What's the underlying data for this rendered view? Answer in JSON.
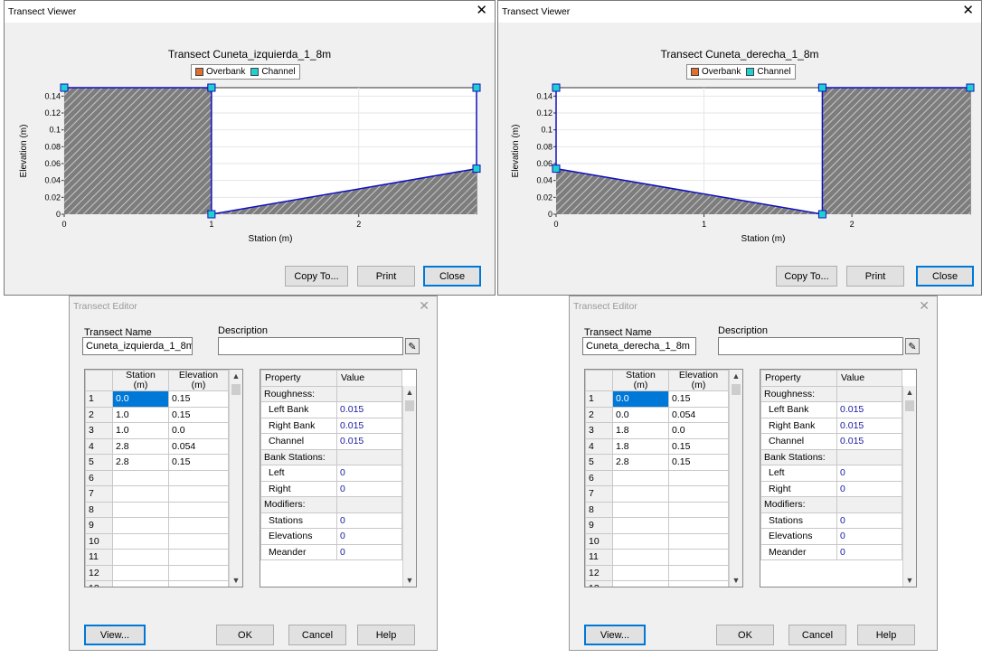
{
  "viewers": [
    {
      "title": "Transect Viewer",
      "chart_title": "Transect Cuneta_izquierda_1_8m",
      "legend": [
        "Overbank",
        "Channel"
      ],
      "buttons": {
        "copy": "Copy To...",
        "print": "Print",
        "close": "Close"
      }
    },
    {
      "title": "Transect Viewer",
      "chart_title": "Transect Cuneta_derecha_1_8m",
      "legend": [
        "Overbank",
        "Channel"
      ],
      "buttons": {
        "copy": "Copy To...",
        "print": "Print",
        "close": "Close"
      }
    }
  ],
  "chart_data": [
    {
      "type": "area",
      "title": "Transect Cuneta_izquierda_1_8m",
      "xlabel": "Station (m)",
      "ylabel": "Elevation (m)",
      "x_ticks": [
        "0",
        "1",
        "2"
      ],
      "y_ticks": [
        "0",
        "0.02",
        "0.04",
        "0.06",
        "0.08",
        "0.1",
        "0.12",
        "0.14"
      ],
      "xlim": [
        0,
        2.8
      ],
      "ylim": [
        0,
        0.15
      ],
      "series": [
        {
          "name": "Overbank",
          "points": [
            [
              0,
              0.15
            ],
            [
              1.0,
              0.15
            ]
          ]
        },
        {
          "name": "Channel",
          "points": [
            [
              1.0,
              0.15
            ],
            [
              1.0,
              0.0
            ],
            [
              2.8,
              0.054
            ],
            [
              2.8,
              0.15
            ]
          ]
        }
      ],
      "colors": {
        "overbank": "#e07030",
        "channel": "#20d0d0",
        "line": "#1010c0"
      }
    },
    {
      "type": "area",
      "title": "Transect Cuneta_derecha_1_8m",
      "xlabel": "Station (m)",
      "ylabel": "Elevation (m)",
      "x_ticks": [
        "0",
        "1",
        "2"
      ],
      "y_ticks": [
        "0",
        "0.02",
        "0.04",
        "0.06",
        "0.08",
        "0.1",
        "0.12",
        "0.14"
      ],
      "xlim": [
        0,
        2.8
      ],
      "ylim": [
        0,
        0.15
      ],
      "series": [
        {
          "name": "Channel",
          "points": [
            [
              0.0,
              0.15
            ],
            [
              0.0,
              0.054
            ],
            [
              1.8,
              0.0
            ],
            [
              1.8,
              0.15
            ]
          ]
        },
        {
          "name": "Overbank",
          "points": [
            [
              1.8,
              0.15
            ],
            [
              2.8,
              0.15
            ]
          ]
        }
      ],
      "colors": {
        "overbank": "#e07030",
        "channel": "#20d0d0",
        "line": "#1010c0"
      }
    }
  ],
  "editors": [
    {
      "title": "Transect Editor",
      "name_label": "Transect Name",
      "name_value": "Cuneta_izquierda_1_8m",
      "desc_label": "Description",
      "desc_value": "",
      "grid_headers": [
        "Station\n(m)",
        "Elevation\n(m)"
      ],
      "rows": [
        [
          "0.0",
          "0.15"
        ],
        [
          "1.0",
          "0.15"
        ],
        [
          "1.0",
          "0.0"
        ],
        [
          "2.8",
          "0.054"
        ],
        [
          "2.8",
          "0.15"
        ],
        [
          "",
          ""
        ],
        [
          "",
          ""
        ],
        [
          "",
          ""
        ],
        [
          "",
          ""
        ],
        [
          "",
          ""
        ],
        [
          "",
          ""
        ],
        [
          "",
          ""
        ],
        [
          "",
          ""
        ]
      ],
      "prop_headers": [
        "Property",
        "Value"
      ],
      "props": [
        {
          "p": "Roughness:",
          "v": "",
          "section": true
        },
        {
          "p": "Left Bank",
          "v": "0.015"
        },
        {
          "p": "Right Bank",
          "v": "0.015"
        },
        {
          "p": "Channel",
          "v": "0.015"
        },
        {
          "p": "Bank Stations:",
          "v": "",
          "section": true
        },
        {
          "p": "Left",
          "v": "0"
        },
        {
          "p": "Right",
          "v": "0"
        },
        {
          "p": "Modifiers:",
          "v": "",
          "section": true
        },
        {
          "p": "Stations",
          "v": "0"
        },
        {
          "p": "Elevations",
          "v": "0"
        },
        {
          "p": "Meander",
          "v": "0"
        }
      ],
      "buttons": {
        "view": "View...",
        "ok": "OK",
        "cancel": "Cancel",
        "help": "Help"
      }
    },
    {
      "title": "Transect Editor",
      "name_label": "Transect Name",
      "name_value": "Cuneta_derecha_1_8m",
      "desc_label": "Description",
      "desc_value": "",
      "grid_headers": [
        "Station\n(m)",
        "Elevation\n(m)"
      ],
      "rows": [
        [
          "0.0",
          "0.15"
        ],
        [
          "0.0",
          "0.054"
        ],
        [
          "1.8",
          "0.0"
        ],
        [
          "1.8",
          "0.15"
        ],
        [
          "2.8",
          "0.15"
        ],
        [
          "",
          ""
        ],
        [
          "",
          ""
        ],
        [
          "",
          ""
        ],
        [
          "",
          ""
        ],
        [
          "",
          ""
        ],
        [
          "",
          ""
        ],
        [
          "",
          ""
        ],
        [
          "",
          ""
        ]
      ],
      "prop_headers": [
        "Property",
        "Value"
      ],
      "props": [
        {
          "p": "Roughness:",
          "v": "",
          "section": true
        },
        {
          "p": "Left Bank",
          "v": "0.015"
        },
        {
          "p": "Right Bank",
          "v": "0.015"
        },
        {
          "p": "Channel",
          "v": "0.015"
        },
        {
          "p": "Bank Stations:",
          "v": "",
          "section": true
        },
        {
          "p": "Left",
          "v": "0"
        },
        {
          "p": "Right",
          "v": "0"
        },
        {
          "p": "Modifiers:",
          "v": "",
          "section": true
        },
        {
          "p": "Stations",
          "v": "0"
        },
        {
          "p": "Elevations",
          "v": "0"
        },
        {
          "p": "Meander",
          "v": "0"
        }
      ],
      "buttons": {
        "view": "View...",
        "ok": "OK",
        "cancel": "Cancel",
        "help": "Help"
      }
    }
  ]
}
